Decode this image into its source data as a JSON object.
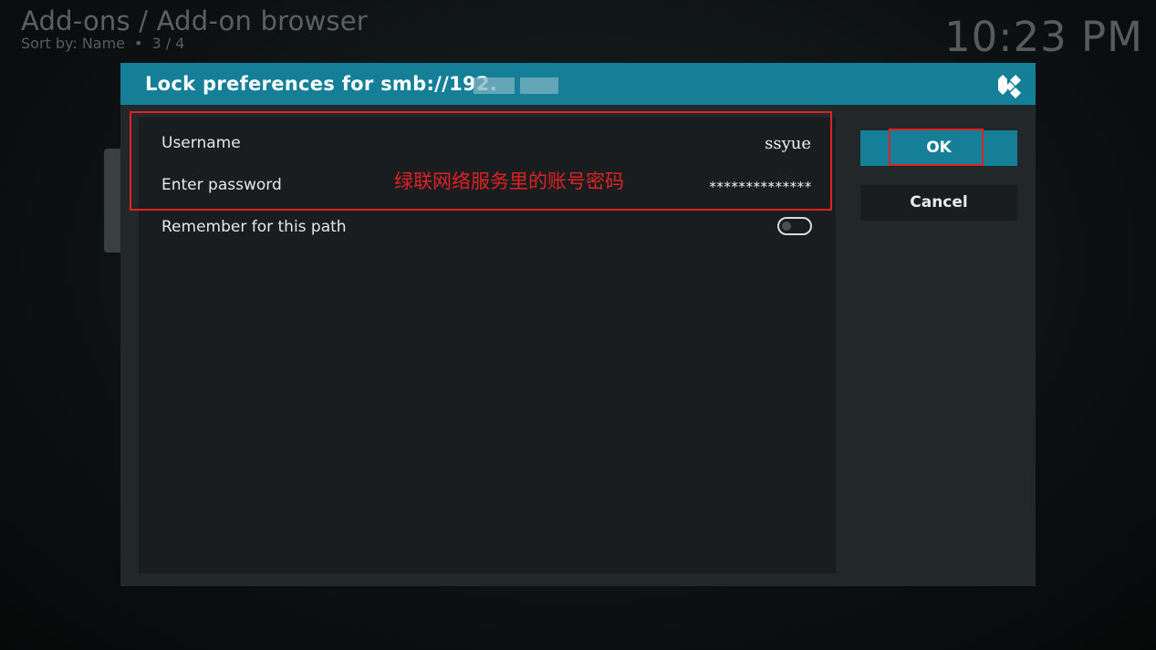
{
  "header": {
    "title": "Add-ons / Add-on browser",
    "sort_label": "Sort by: Name",
    "separator": "•",
    "page_indicator": "3 / 4",
    "clock": "10:23 PM"
  },
  "dialog": {
    "title": "Lock preferences for smb://192.",
    "logo": "kodi-logo-icon",
    "rows": [
      {
        "label": "Username",
        "value": "ssyue"
      },
      {
        "label": "Enter password",
        "value": "**************"
      },
      {
        "label": "Remember for this path",
        "toggle_on": false
      }
    ],
    "ok_label": "OK",
    "cancel_label": "Cancel"
  },
  "annotation": {
    "text": "绿联网络服务里的账号密码",
    "color": "#e02222"
  },
  "colors": {
    "accent": "#157f98",
    "dialog_bg": "#22272a",
    "panel_bg": "#191d1f"
  }
}
